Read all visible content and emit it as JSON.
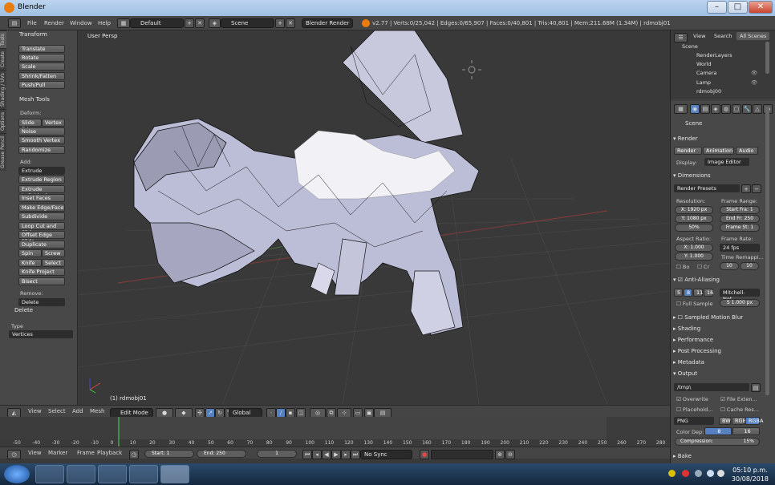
{
  "window": {
    "title": "Blender",
    "btn_min": "–",
    "btn_max": "□",
    "btn_close": "✕"
  },
  "info": {
    "menus": [
      "File",
      "Render",
      "Window",
      "Help"
    ],
    "layout": "Default",
    "scene": "Scene",
    "engine": "Blender Render",
    "stats": "v2.77 | Verts:0/25,042 | Edges:0/65,907 | Faces:0/40,801 | Tris:40,801 | Mem:211.68M (1.34M) | rdmobj01",
    "btn_add": "+",
    "btn_remove": "✕"
  },
  "vtabs": [
    "Tools",
    "Create",
    "Shading / UVs",
    "Options",
    "Grease Pencil"
  ],
  "toolshelf": {
    "transform_title": "Transform",
    "transform": [
      "Translate",
      "Rotate",
      "Scale",
      "Shrink/Fatten",
      "Push/Pull"
    ],
    "mesh_tools_title": "Mesh Tools",
    "deform_label": "Deform:",
    "slide_edge": "Slide Ed",
    "vertex": "Vertex",
    "noise": "Noise",
    "smooth_vertex": "Smooth Vertex",
    "randomize": "Randomize",
    "add_label": "Add:",
    "extrude": "Extrude",
    "add_items": [
      "Extrude Region",
      "Extrude Individual",
      "Inset Faces",
      "Make Edge/Face",
      "Subdivide",
      "Loop Cut and Slide",
      "Offset Edge Slide",
      "Duplicate"
    ],
    "spin": "Spin",
    "screw": "Screw",
    "knife": "Knife",
    "select": "Select",
    "knife_project": "Knife Project",
    "bisect": "Bisect",
    "remove_label": "Remove:",
    "delete": "Delete",
    "op_title": "Delete",
    "type_label": "Type",
    "type_value": "Vertices"
  },
  "viewport": {
    "label": "User Persp",
    "object": "(1) rdmobj01"
  },
  "view_header": {
    "items": [
      "View",
      "Select",
      "Add",
      "Mesh"
    ],
    "mode": "Edit Mode",
    "orientation": "Global"
  },
  "timeline": {
    "ticks": [
      "-50",
      "-40",
      "-30",
      "-20",
      "-10",
      "0",
      "10",
      "20",
      "30",
      "40",
      "50",
      "60",
      "70",
      "80",
      "90",
      "100",
      "110",
      "120",
      "130",
      "140",
      "150",
      "160",
      "170",
      "180",
      "190",
      "200",
      "210",
      "220",
      "230",
      "240",
      "250",
      "260",
      "270",
      "280"
    ],
    "items": [
      "View",
      "Marker",
      "Frame",
      "Playback"
    ],
    "start_label": "Start:",
    "start": "1",
    "end_label": "End:",
    "end": "250",
    "current": "1",
    "sync": "No Sync",
    "current_frame_fraction": 0.0
  },
  "outliner": {
    "tabs": [
      "View",
      "Search",
      "All Scenes"
    ],
    "items": [
      "Scene",
      "RenderLayers",
      "World",
      "Camera",
      "Lamp",
      "rdmobj00"
    ]
  },
  "properties": {
    "context": "Scene",
    "render_title": "Render",
    "render_btn": "Render",
    "animation_btn": "Animation",
    "audio_btn": "Audio",
    "display_label": "Display:",
    "display_value": "Image Editor",
    "dimensions_title": "Dimensions",
    "presets": "Render Presets",
    "resolution_label": "Resolution:",
    "res_x": "X: 1920 px",
    "res_y": "Y: 1080 px",
    "res_pct": "50%",
    "frame_range_label": "Frame Range:",
    "start_frame": "Start Fra: 1",
    "end_frame": "End Fr: 250",
    "frame_step": "Frame St: 1",
    "aspect_label": "Aspect Ratio:",
    "asp_x": "X: 1.000",
    "asp_y": "Y: 1.000",
    "frame_rate_label": "Frame Rate:",
    "fps": "24 fps",
    "time_remap_label": "Time Remappi...",
    "remap_a": "10",
    "remap_b": "10",
    "bo": "Bo",
    "cr": "Cr",
    "aa_title": "Anti-Aliasing",
    "aa_samples": [
      "5",
      "8",
      "11",
      "16"
    ],
    "aa_filter": "Mitchell-Net...",
    "full_sample": "Full Sample",
    "filter_size": "S 1.000 px",
    "collapsed": [
      "Sampled Motion Blur",
      "Shading",
      "Performance",
      "Post Processing",
      "Metadata"
    ],
    "output_title": "Output",
    "output_path": "/tmp\\",
    "overwrite": "Overwrite",
    "file_ext": "File Exten...",
    "placeholders": "Placehold...",
    "cache": "Cache Res...",
    "format": "PNG",
    "bw": "BW",
    "rgb": "RGB",
    "rgba": "RGBA",
    "color_depth_label": "Color Dep:",
    "depth8": "8",
    "depth16": "16",
    "compression": "Compression:",
    "compression_val": "15%",
    "bake_title": "Bake"
  },
  "taskbar": {
    "time": "05:10 p.m.",
    "date": "30/08/2018"
  },
  "colors": {
    "accent": "#5680c2",
    "selected": "#4a72b0",
    "timeline_cursor": "#4fc04f",
    "mesh": "#d9d9f0"
  }
}
